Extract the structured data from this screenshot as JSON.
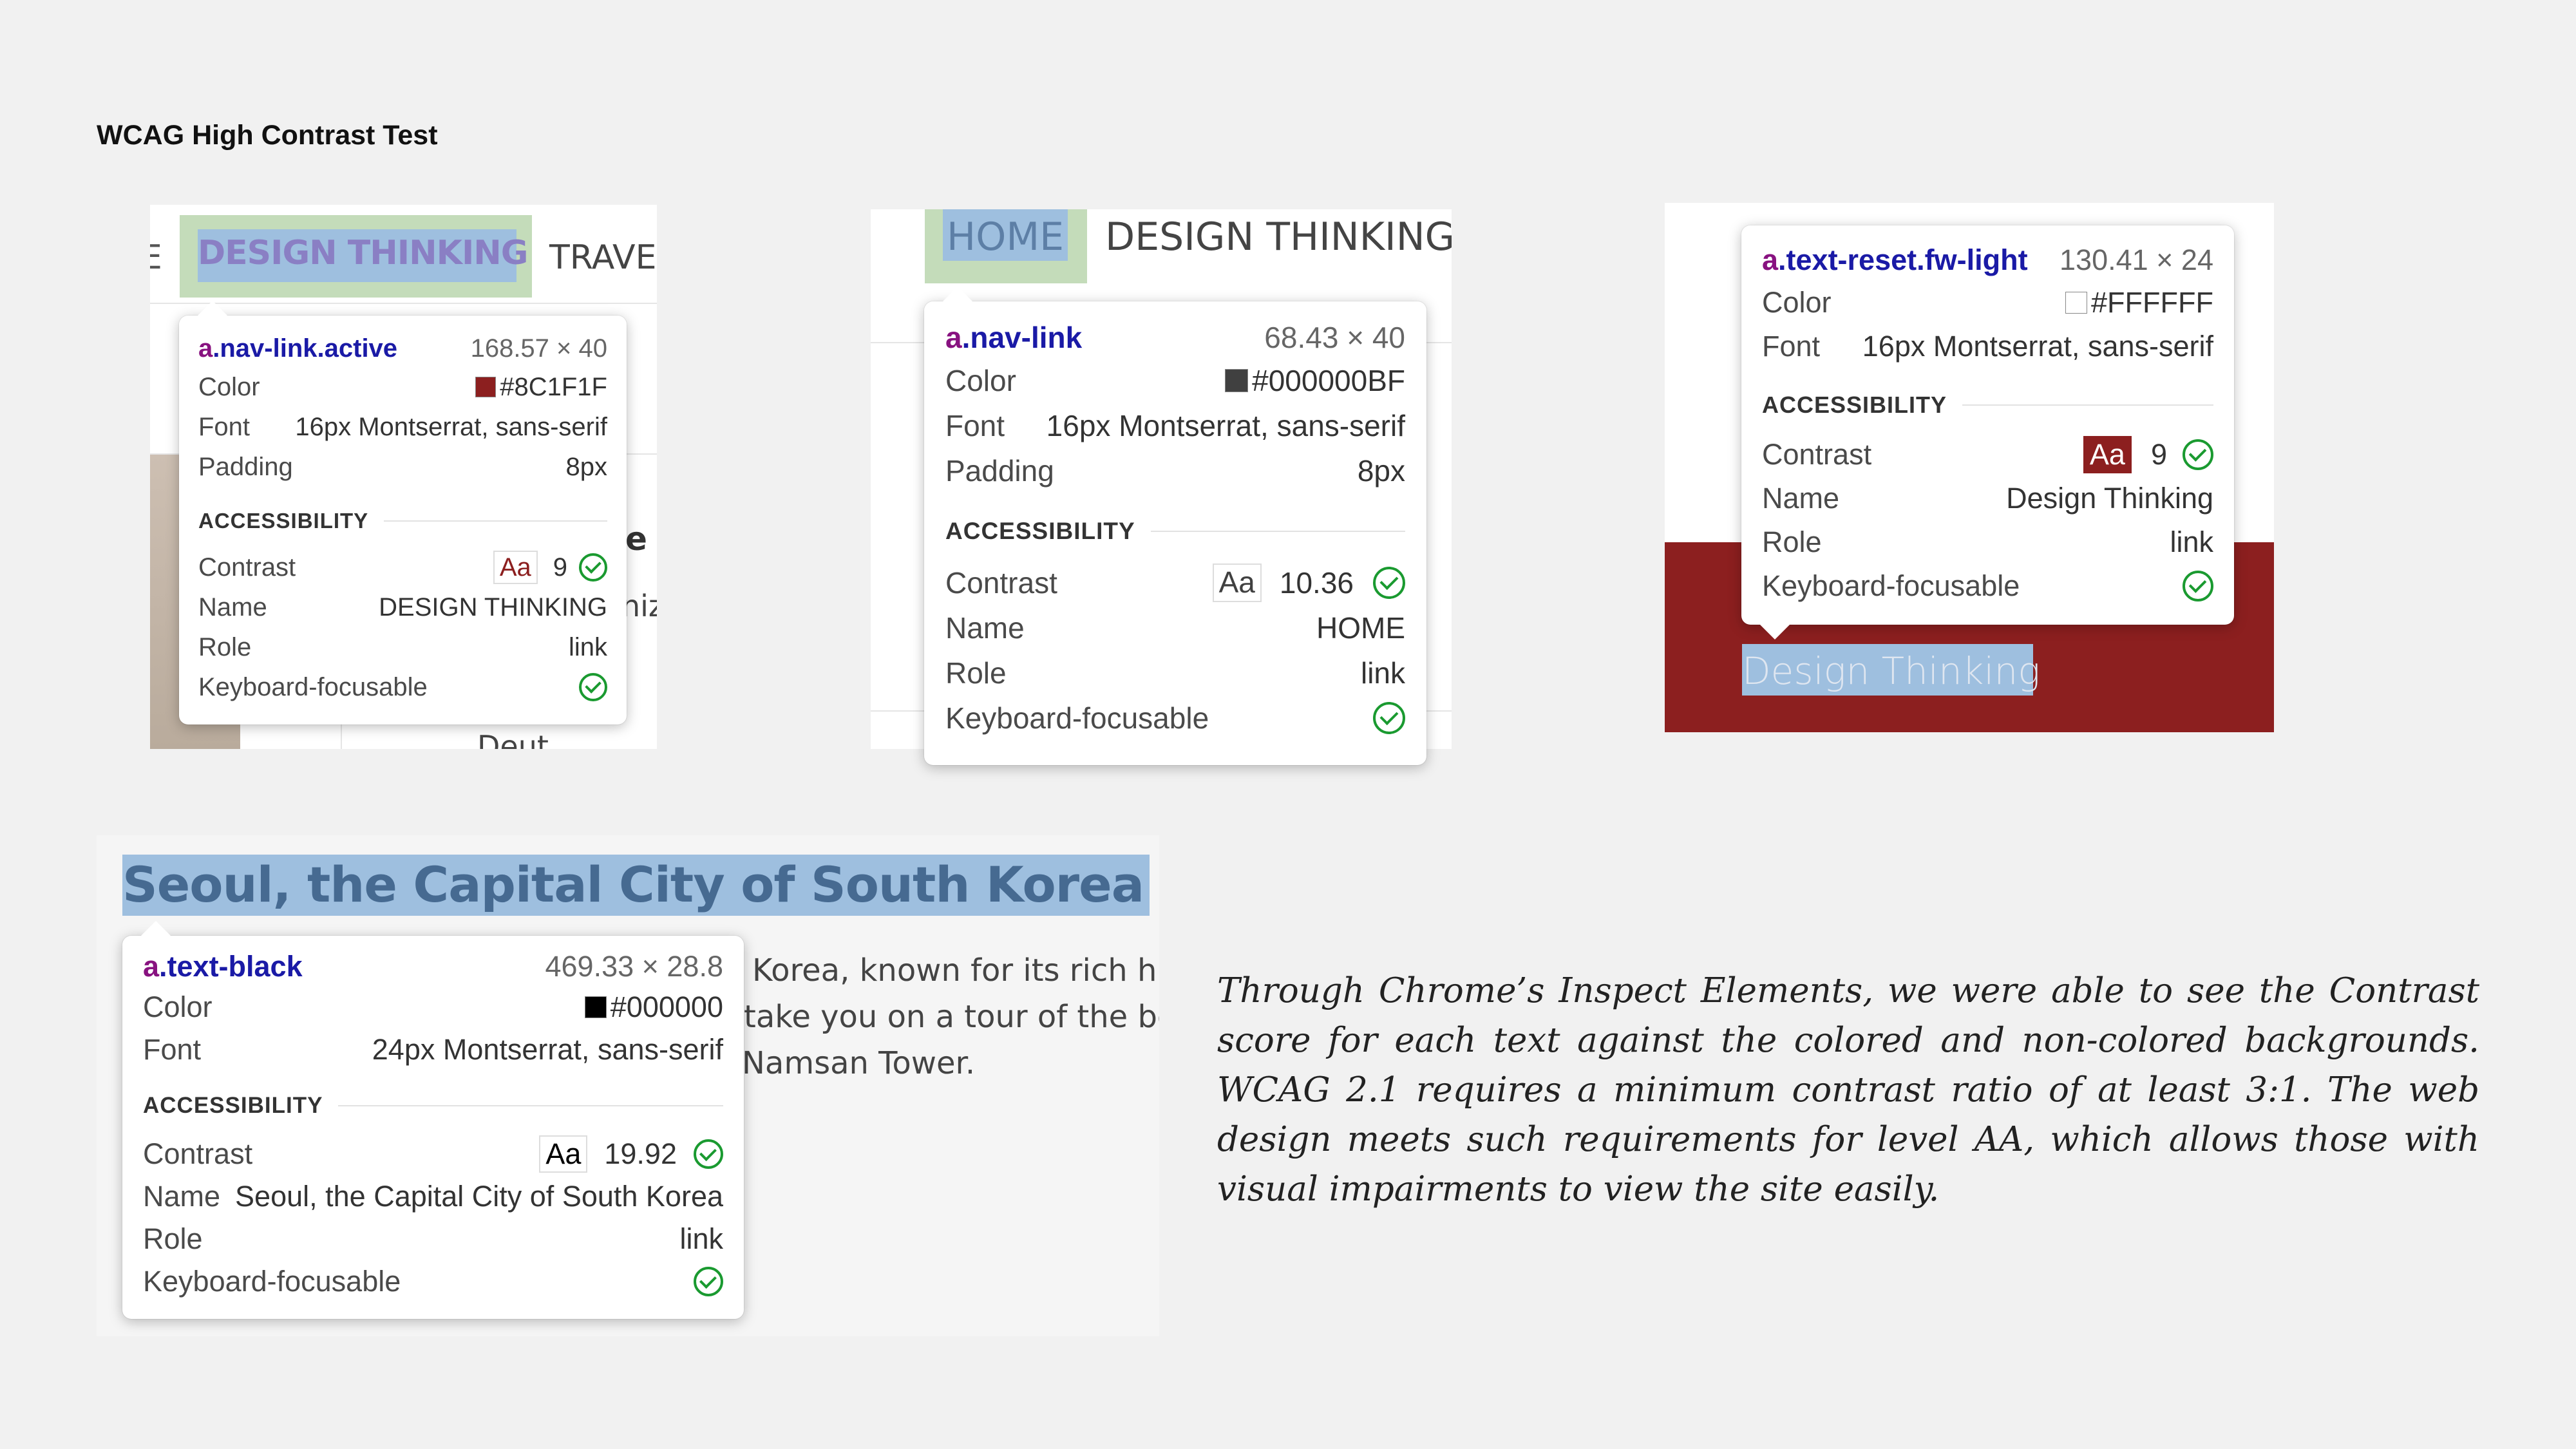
{
  "page": {
    "title": "WCAG High Contrast Test"
  },
  "panel1": {
    "nav_left_fragment": "E",
    "nav_active": "DESIGN THINKING",
    "nav_next": "TRAVE",
    "bg_fragment_1": "e",
    "bg_fragment_2": "niz",
    "bg_fragment_3": "Deut",
    "tooltip": {
      "selector_tag": "a",
      "selector_class": ".nav-link.active",
      "size": "168.57 × 40",
      "color_label": "Color",
      "color_value": "#8C1F1F",
      "color_swatch": "#8c1f1f",
      "font_label": "Font",
      "font_value": "16px Montserrat, sans-serif",
      "padding_label": "Padding",
      "padding_value": "8px",
      "section": "ACCESSIBILITY",
      "contrast_label": "Contrast",
      "contrast_sample": "Aa",
      "contrast_value": "9",
      "name_label": "Name",
      "name_value": "DESIGN THINKING",
      "role_label": "Role",
      "role_value": "link",
      "focus_label": "Keyboard-focusable"
    }
  },
  "panel2": {
    "nav_home": "HOME",
    "nav_next": "DESIGN THINKING",
    "tooltip": {
      "selector_tag": "a",
      "selector_class": ".nav-link",
      "size": "68.43 × 40",
      "color_label": "Color",
      "color_value": "#000000BF",
      "color_swatch": "#404040",
      "font_label": "Font",
      "font_value": "16px Montserrat, sans-serif",
      "padding_label": "Padding",
      "padding_value": "8px",
      "section": "ACCESSIBILITY",
      "contrast_label": "Contrast",
      "contrast_sample": "Aa",
      "contrast_value": "10.36",
      "name_label": "Name",
      "name_value": "HOME",
      "role_label": "Role",
      "role_value": "link",
      "focus_label": "Keyboard-focusable"
    }
  },
  "panel3": {
    "link_text": "Design Thinking",
    "band_color": "#8c1f1f",
    "tooltip": {
      "selector_tag": "a",
      "selector_class": ".text-reset.fw-light",
      "size": "130.41 × 24",
      "color_label": "Color",
      "color_value": "#FFFFFF",
      "color_swatch": "#ffffff",
      "font_label": "Font",
      "font_value": "16px Montserrat, sans-serif",
      "section": "ACCESSIBILITY",
      "contrast_label": "Contrast",
      "contrast_sample": "Aa",
      "contrast_value": "9",
      "name_label": "Name",
      "name_value": "Design Thinking",
      "role_label": "Role",
      "role_value": "link",
      "focus_label": "Keyboard-focusable"
    }
  },
  "panel4": {
    "heading": "Seoul, the Capital City of South Korea",
    "body_line_1": "Korea, known for its rich hi",
    "body_line_2": "take you on a tour of the be",
    "body_line_3": "Namsan Tower.",
    "tooltip": {
      "selector_tag": "a",
      "selector_class": ".text-black",
      "size": "469.33 × 28.8",
      "color_label": "Color",
      "color_value": "#000000",
      "color_swatch": "#000000",
      "font_label": "Font",
      "font_value": "24px Montserrat, sans-serif",
      "section": "ACCESSIBILITY",
      "contrast_label": "Contrast",
      "contrast_sample": "Aa",
      "contrast_value": "19.92",
      "name_label": "Name",
      "name_value": "Seoul, the Capital City of South Korea",
      "role_label": "Role",
      "role_value": "link",
      "focus_label": "Keyboard-focusable"
    }
  },
  "note": {
    "text": "Through Chrome’s Inspect Elements, we were able to see the Contrast score for each text against the colored and non-colored backgrounds. WCAG 2.1 requires a minimum contrast ratio of at least 3:1. The web design meets such requirements for level AA, which allows those with visual impairments to view the site easily."
  }
}
